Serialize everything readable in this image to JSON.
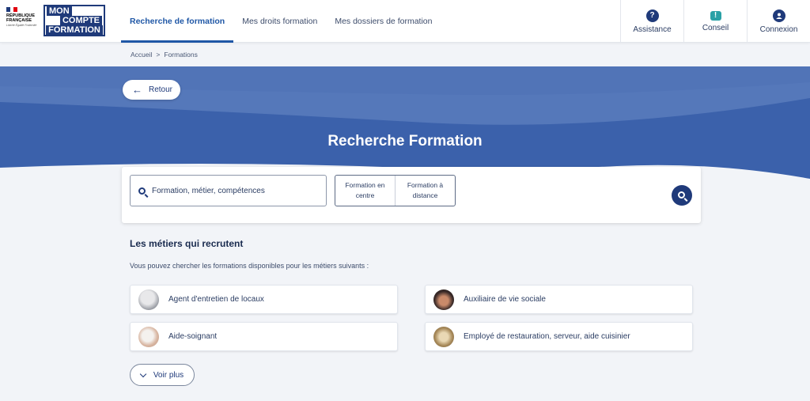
{
  "brand": {
    "republic_label_1": "RÉPUBLIQUE",
    "republic_label_2": "FRANÇAISE",
    "republic_motto": "Liberté Égalité Fraternité",
    "logo_line1": "MON",
    "logo_line2": "COMPTE",
    "logo_line3": "FORMATION"
  },
  "nav": {
    "items": [
      {
        "label": "Recherche de formation",
        "active": true
      },
      {
        "label": "Mes droits formation",
        "active": false
      },
      {
        "label": "Mes dossiers de formation",
        "active": false
      }
    ]
  },
  "actions": {
    "assistance": "Assistance",
    "conseil": "Conseil",
    "connexion": "Connexion"
  },
  "breadcrumb": {
    "home": "Accueil",
    "separator": ">",
    "current": "Formations"
  },
  "hero": {
    "back_label": "Retour",
    "title": "Recherche Formation"
  },
  "search": {
    "placeholder": "Formation, métier, compétences",
    "mode_center": "Formation en centre",
    "mode_distance": "Formation à distance"
  },
  "metiers": {
    "title": "Les métiers qui recrutent",
    "subtitle": "Vous pouvez chercher les formations disponibles pour les métiers suivants :",
    "jobs": [
      {
        "label": "Agent d'entretien de locaux"
      },
      {
        "label": "Auxiliaire de vie sociale"
      },
      {
        "label": "Aide-soignant"
      },
      {
        "label": "Employé de restauration, serveur, aide cuisinier"
      }
    ],
    "see_more": "Voir plus"
  },
  "colors": {
    "primary": "#1f3a7a",
    "active_nav": "#1f57a6",
    "hero_dark": "#3d63ad",
    "hero_light": "#5a7dbf",
    "conseil": "#2aa1a6"
  }
}
